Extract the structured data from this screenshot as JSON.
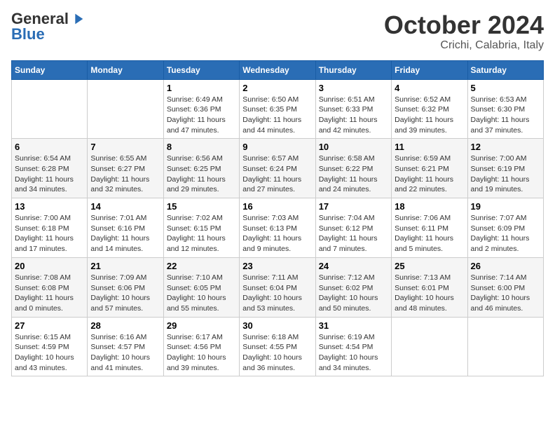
{
  "header": {
    "logo_general": "General",
    "logo_blue": "Blue",
    "title": "October 2024",
    "location": "Crichi, Calabria, Italy"
  },
  "weekdays": [
    "Sunday",
    "Monday",
    "Tuesday",
    "Wednesday",
    "Thursday",
    "Friday",
    "Saturday"
  ],
  "weeks": [
    [
      {
        "day": "",
        "info": ""
      },
      {
        "day": "",
        "info": ""
      },
      {
        "day": "1",
        "info": "Sunrise: 6:49 AM\nSunset: 6:36 PM\nDaylight: 11 hours and 47 minutes."
      },
      {
        "day": "2",
        "info": "Sunrise: 6:50 AM\nSunset: 6:35 PM\nDaylight: 11 hours and 44 minutes."
      },
      {
        "day": "3",
        "info": "Sunrise: 6:51 AM\nSunset: 6:33 PM\nDaylight: 11 hours and 42 minutes."
      },
      {
        "day": "4",
        "info": "Sunrise: 6:52 AM\nSunset: 6:32 PM\nDaylight: 11 hours and 39 minutes."
      },
      {
        "day": "5",
        "info": "Sunrise: 6:53 AM\nSunset: 6:30 PM\nDaylight: 11 hours and 37 minutes."
      }
    ],
    [
      {
        "day": "6",
        "info": "Sunrise: 6:54 AM\nSunset: 6:28 PM\nDaylight: 11 hours and 34 minutes."
      },
      {
        "day": "7",
        "info": "Sunrise: 6:55 AM\nSunset: 6:27 PM\nDaylight: 11 hours and 32 minutes."
      },
      {
        "day": "8",
        "info": "Sunrise: 6:56 AM\nSunset: 6:25 PM\nDaylight: 11 hours and 29 minutes."
      },
      {
        "day": "9",
        "info": "Sunrise: 6:57 AM\nSunset: 6:24 PM\nDaylight: 11 hours and 27 minutes."
      },
      {
        "day": "10",
        "info": "Sunrise: 6:58 AM\nSunset: 6:22 PM\nDaylight: 11 hours and 24 minutes."
      },
      {
        "day": "11",
        "info": "Sunrise: 6:59 AM\nSunset: 6:21 PM\nDaylight: 11 hours and 22 minutes."
      },
      {
        "day": "12",
        "info": "Sunrise: 7:00 AM\nSunset: 6:19 PM\nDaylight: 11 hours and 19 minutes."
      }
    ],
    [
      {
        "day": "13",
        "info": "Sunrise: 7:00 AM\nSunset: 6:18 PM\nDaylight: 11 hours and 17 minutes."
      },
      {
        "day": "14",
        "info": "Sunrise: 7:01 AM\nSunset: 6:16 PM\nDaylight: 11 hours and 14 minutes."
      },
      {
        "day": "15",
        "info": "Sunrise: 7:02 AM\nSunset: 6:15 PM\nDaylight: 11 hours and 12 minutes."
      },
      {
        "day": "16",
        "info": "Sunrise: 7:03 AM\nSunset: 6:13 PM\nDaylight: 11 hours and 9 minutes."
      },
      {
        "day": "17",
        "info": "Sunrise: 7:04 AM\nSunset: 6:12 PM\nDaylight: 11 hours and 7 minutes."
      },
      {
        "day": "18",
        "info": "Sunrise: 7:06 AM\nSunset: 6:11 PM\nDaylight: 11 hours and 5 minutes."
      },
      {
        "day": "19",
        "info": "Sunrise: 7:07 AM\nSunset: 6:09 PM\nDaylight: 11 hours and 2 minutes."
      }
    ],
    [
      {
        "day": "20",
        "info": "Sunrise: 7:08 AM\nSunset: 6:08 PM\nDaylight: 11 hours and 0 minutes."
      },
      {
        "day": "21",
        "info": "Sunrise: 7:09 AM\nSunset: 6:06 PM\nDaylight: 10 hours and 57 minutes."
      },
      {
        "day": "22",
        "info": "Sunrise: 7:10 AM\nSunset: 6:05 PM\nDaylight: 10 hours and 55 minutes."
      },
      {
        "day": "23",
        "info": "Sunrise: 7:11 AM\nSunset: 6:04 PM\nDaylight: 10 hours and 53 minutes."
      },
      {
        "day": "24",
        "info": "Sunrise: 7:12 AM\nSunset: 6:02 PM\nDaylight: 10 hours and 50 minutes."
      },
      {
        "day": "25",
        "info": "Sunrise: 7:13 AM\nSunset: 6:01 PM\nDaylight: 10 hours and 48 minutes."
      },
      {
        "day": "26",
        "info": "Sunrise: 7:14 AM\nSunset: 6:00 PM\nDaylight: 10 hours and 46 minutes."
      }
    ],
    [
      {
        "day": "27",
        "info": "Sunrise: 6:15 AM\nSunset: 4:59 PM\nDaylight: 10 hours and 43 minutes."
      },
      {
        "day": "28",
        "info": "Sunrise: 6:16 AM\nSunset: 4:57 PM\nDaylight: 10 hours and 41 minutes."
      },
      {
        "day": "29",
        "info": "Sunrise: 6:17 AM\nSunset: 4:56 PM\nDaylight: 10 hours and 39 minutes."
      },
      {
        "day": "30",
        "info": "Sunrise: 6:18 AM\nSunset: 4:55 PM\nDaylight: 10 hours and 36 minutes."
      },
      {
        "day": "31",
        "info": "Sunrise: 6:19 AM\nSunset: 4:54 PM\nDaylight: 10 hours and 34 minutes."
      },
      {
        "day": "",
        "info": ""
      },
      {
        "day": "",
        "info": ""
      }
    ]
  ]
}
